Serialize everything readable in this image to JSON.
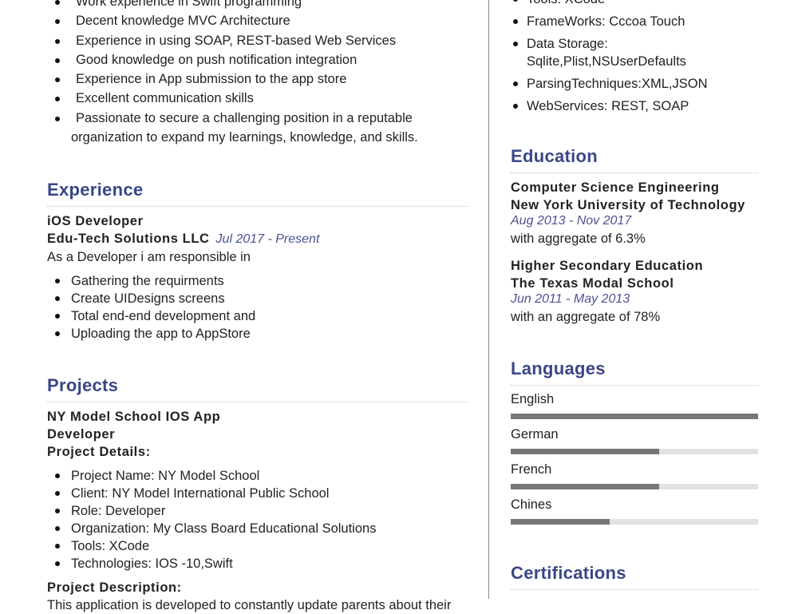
{
  "summary": {
    "items": [
      "Work experience in Swift programming",
      "Decent knowledge MVC Architecture",
      "Experience in using SOAP, REST-based Web Services",
      "Good knowledge on push notification integration",
      "Experience in App submission to the app store",
      "Excellent communication skills"
    ],
    "last_item_line1": "Passionate to secure a challenging position in a reputable",
    "last_item_line2": "organization to expand my learnings, knowledge, and skills."
  },
  "experience": {
    "title": "Experience",
    "role": "iOS Developer",
    "company": "Edu-Tech Solutions LLC",
    "dates": "Jul 2017 - Present",
    "intro": "As a Developer i am responsible in",
    "items": [
      "Gathering the requirments",
      "Create UIDesigns  screens",
      "Total end-end  development and",
      "Uploading the app to AppStore"
    ]
  },
  "projects": {
    "title": "Projects",
    "name": "NY Model School IOS App",
    "role": "Developer",
    "details_label": "Project Details:",
    "details": [
      "Project Name: NY Model School",
      "Client: NY Model International Public School",
      "Role: Developer",
      "Organization: My Class Board Educational Solutions",
      "Tools: XCode",
      "Technologies: IOS -10,Swift"
    ],
    "description_label": "Project Description:",
    "description": "This application is developed to constantly update parents about their"
  },
  "skills": {
    "items": [
      "Tools: XCode",
      "FrameWorks: Cccoa Touch",
      "Data Storage: Sqlite,Plist,NSUserDefaults",
      "ParsingTechniques:XML,JSON",
      "WebServices: REST, SOAP"
    ]
  },
  "education": {
    "title": "Education",
    "entries": [
      {
        "degree": "Computer Science Engineering",
        "school": "New York University of Technology",
        "dates": "Aug 2013 - Nov 2017",
        "note": "with aggregate of 6.3%"
      },
      {
        "degree": "Higher Secondary Education",
        "school": "The Texas Modal School",
        "dates": "Jun 2011 - May 2013",
        "note": "with an aggregate of 78%"
      }
    ]
  },
  "languages": {
    "title": "Languages",
    "items": [
      {
        "name": "English",
        "level": 1.0
      },
      {
        "name": "German",
        "level": 0.6
      },
      {
        "name": "French",
        "level": 0.6
      },
      {
        "name": "Chines",
        "level": 0.4
      }
    ]
  },
  "certifications": {
    "title": "Certifications"
  }
}
